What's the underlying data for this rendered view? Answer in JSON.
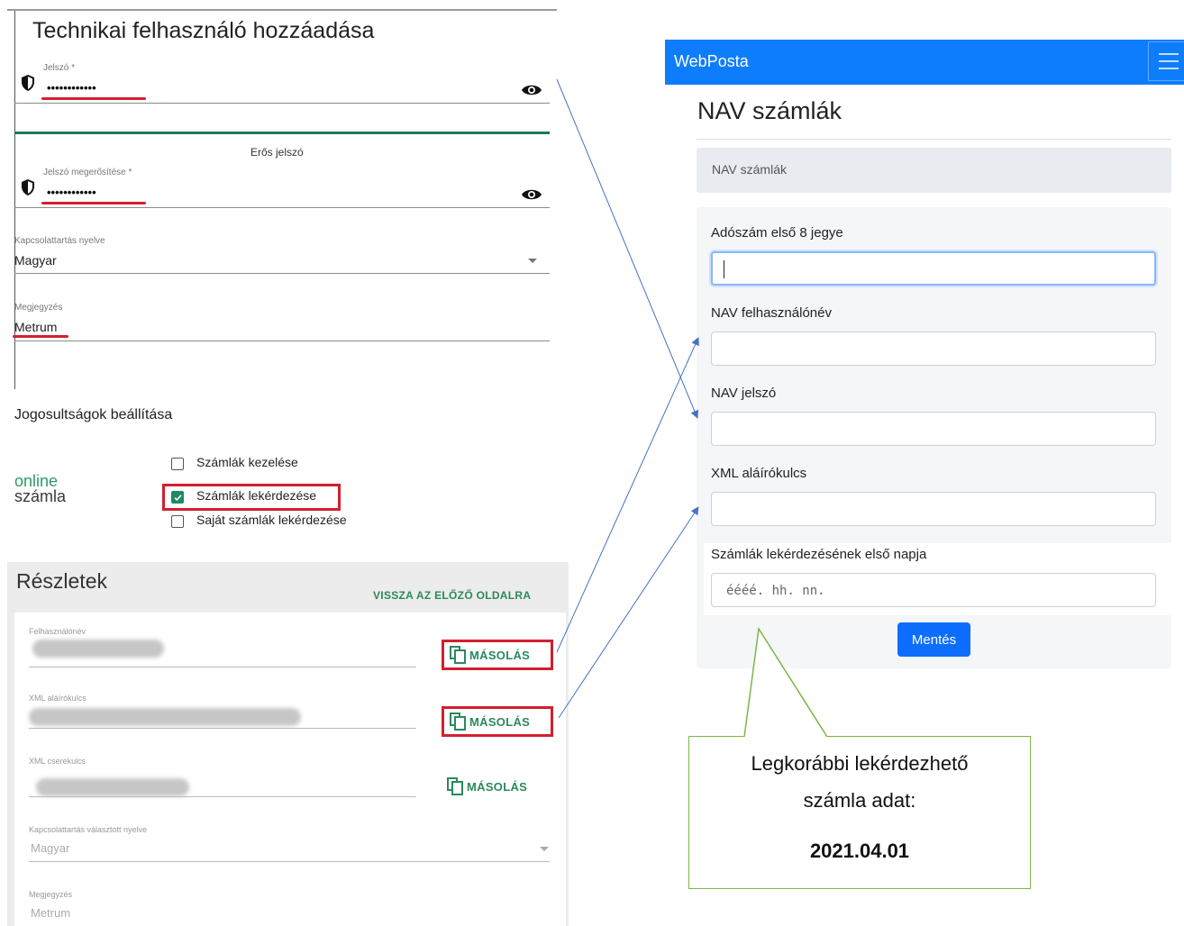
{
  "tech_user": {
    "title": "Technikai felhasználó hozzáadása",
    "password_label": "Jelszó *",
    "password_value": "••••••••••••",
    "strength_text": "Erős jelszó",
    "confirm_label": "Jelszó megerősítése *",
    "confirm_value": "••••••••••••",
    "language_label": "Kapcsolattartás nyelve",
    "language_value": "Magyar",
    "note_label": "Megjegyzés",
    "note_value": "Metrum",
    "permissions_title": "Jogosultságok beállítása",
    "logo_line1": "online",
    "logo_line2": "számla",
    "permissions": [
      {
        "label": "Számlák kezelése",
        "checked": false
      },
      {
        "label": "Számlák lekérdezése",
        "checked": true
      },
      {
        "label": "Saját számlák lekérdezése",
        "checked": false
      }
    ]
  },
  "details": {
    "title": "Részletek",
    "back_link": "VISSZA AZ ELŐZŐ OLDALRA",
    "copy_label": "MÁSOLÁS",
    "fields": [
      {
        "label": "Felhasználónév"
      },
      {
        "label": "XML aláírókulcs"
      },
      {
        "label": "XML cserekulcs"
      }
    ],
    "language_label": "Kapcsolattartás választott nyelve",
    "language_value": "Magyar",
    "note_label": "Megjegyzés",
    "note_value": "Metrum"
  },
  "webposta": {
    "brand": "WebPosta",
    "page_title": "NAV számlák",
    "breadcrumb": "NAV számlák",
    "tax_label": "Adószám első 8 jegye",
    "user_label": "NAV felhasználónév",
    "password_label": "NAV jelszó",
    "xml_key_label": "XML aláírókulcs",
    "date_label": "Számlák lekérdezésének első napja",
    "date_placeholder": "éééé. hh. nn.",
    "save_button": "Mentés"
  },
  "callout": {
    "line1": "Legkorábbi lekérdezhető",
    "line2": "számla adat:",
    "date": "2021.04.01"
  },
  "colors": {
    "webposta_blue": "#0d7dfc",
    "accent_green": "#2a8a5c",
    "highlight_red": "#d2202f",
    "arrow_blue": "#4472c4",
    "callout_green": "#7ab648"
  }
}
